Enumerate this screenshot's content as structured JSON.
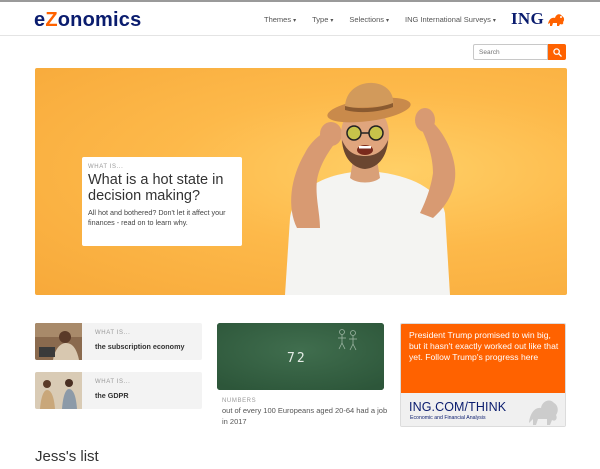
{
  "brand": {
    "logo_prefix": "e",
    "logo_z": "Z",
    "logo_suffix": "onomics",
    "accent": "#ff6200",
    "navy": "#0a1c6e"
  },
  "nav": {
    "items": [
      {
        "label": "Themes",
        "caret": "▾"
      },
      {
        "label": "Type",
        "caret": "▾"
      },
      {
        "label": "Selections",
        "caret": "▾"
      },
      {
        "label": "ING International Surveys",
        "caret": "▾"
      }
    ],
    "ing_logo": "ING"
  },
  "search": {
    "placeholder": "Search",
    "icon": "search-icon"
  },
  "hero": {
    "eyebrow": "WHAT IS...",
    "title": "What is a hot state in decision making?",
    "subtitle": "All hot and bothered? Don't let it affect your finances - read on to learn why."
  },
  "cards": [
    {
      "eyebrow": "WHAT IS...",
      "title": "the subscription economy"
    },
    {
      "eyebrow": "WHAT IS...",
      "title": "the GDPR"
    }
  ],
  "numbers_card": {
    "board_text": "72",
    "eyebrow": "NUMBERS",
    "text": "out of every 100 Europeans aged 20-64 had a job in 2017"
  },
  "ad": {
    "text": "President Trump promised to win big, but it hasn't exactly worked out like that yet. Follow Trump's progress here",
    "url": "ING.COM/THINK",
    "sub": "Economic and Financial Analysis"
  },
  "section": {
    "title": "Jess's list"
  }
}
